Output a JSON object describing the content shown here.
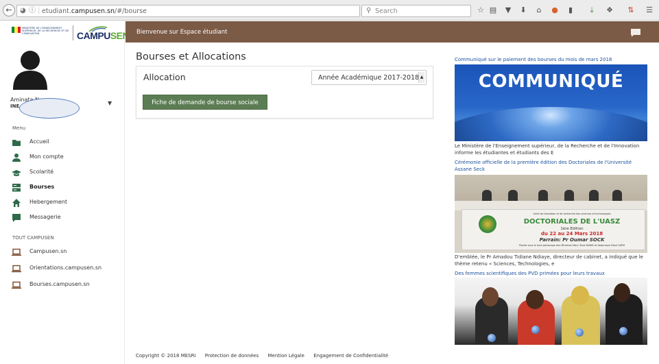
{
  "browser": {
    "url_prefix": "etudiant.",
    "url_domain": "campusen.sn",
    "url_path": "/#/bourse",
    "search_placeholder": "Search"
  },
  "logo": {
    "ministry": "Ministère de l'Enseignement supérieur, de la Recherche et de l'Innovation",
    "brand_main": "CAMPU",
    "brand_accent": "SEN"
  },
  "user": {
    "name": "Aminata N...",
    "ine": "INE"
  },
  "menu": {
    "header": "Menu",
    "items": [
      {
        "label": "Accueil",
        "icon": "folder-icon"
      },
      {
        "label": "Mon compte",
        "icon": "user-icon"
      },
      {
        "label": "Scolarité",
        "icon": "graduation-cap-icon"
      },
      {
        "label": "Bourses",
        "icon": "server-icon"
      },
      {
        "label": "Hebergement",
        "icon": "home-icon"
      },
      {
        "label": "Messagerie",
        "icon": "chat-icon"
      }
    ],
    "section2_header": "TOUT CAMPUSEN",
    "links": [
      {
        "label": "Campusen.sn",
        "icon": "laptop-icon"
      },
      {
        "label": "Orientations.campusen.sn",
        "icon": "laptop-icon"
      },
      {
        "label": "Bourses.campusen.sn",
        "icon": "laptop-icon"
      }
    ]
  },
  "header": {
    "title": "Bienvenue sur Espace étudiant"
  },
  "main": {
    "page_title": "Bourses et Allocations",
    "card_title": "Allocation",
    "year_selected": "Année Académique 2017-2018",
    "fiche_button": "Fiche de demande de bourse sociale"
  },
  "news": [
    {
      "title": "Communiqué sur le paiement des bourses du mois de mars 2018",
      "image_word": "COMMUNIQUÉ",
      "text": "Le Ministère de l'Enseignement supérieur, de la Recherche et de l'Innovation informe les étudiantes et étudiants des E"
    },
    {
      "title": "Cérémonie officielle de la première édition des Doctoriales de l'Université Assane Seck",
      "banner_line1": "Unité de formation et de recherche des sciences et technologies",
      "banner_title": "DOCTORIALES DE L'UASZ",
      "banner_edition": "1ère Edition",
      "banner_date": "du 22 au 24 Mars 2018",
      "banner_parrain": "Parrain: Pr Oumar SOCK",
      "banner_foot": "Placée sous le haut patronage des Ministres Mary Teuw NIANE et Abdoulaye Diouf SARR",
      "text": "D'emblée, le Pr Amadou Tidiane Ndiaye, directeur de cabinet, a indiqué que le thème retenu « Sciences, Technologies, e"
    },
    {
      "title": "Des femmes scientifiques des PVD primées pour leurs travaux"
    }
  ],
  "footer": {
    "copyright": "Copyright © 2018 MESRI",
    "links": [
      "Protection de données",
      "Mention Légale",
      "Engagement de Confidentialité"
    ]
  },
  "colors": {
    "header_bg": "#7b5a46",
    "button_bg": "#5c7d53",
    "link": "#1a4f9c",
    "menu_icon": "#2f6b4a"
  }
}
